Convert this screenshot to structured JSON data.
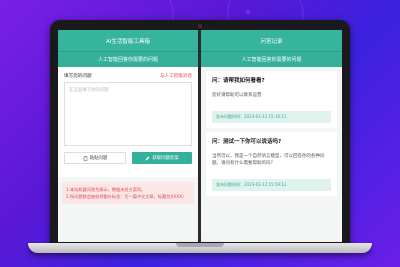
{
  "theme": {
    "accent": "#37b49e",
    "warning": "#e04848",
    "background": "#6a1ee9"
  },
  "left_panel": {
    "window_title": "AI生活智能工具箱",
    "subheader": "人工智能回答你需要的问题",
    "ask_label": "填写您的问题",
    "ask_link": "与人工智能对话",
    "textarea_placeholder": "在这里填写你的问题",
    "copy_button": "粘贴问题",
    "submit_button": "获取问题答案",
    "notice_lines": [
      "1.本站机器问答为演示，数据未经方案同。",
      "2.所问题都会被收到额外标签：写一篇中文文章，标题为XXXX）"
    ]
  },
  "right_panel": {
    "window_title": "问答记录",
    "subheader": "人工智能回答你需要的问题",
    "cards": [
      {
        "question": "问：请帮我如何看看?",
        "answer": "您好请帮助可以联系运营",
        "meta": "发布问题时间：2023-03-12 15:16:11"
      },
      {
        "question": "问：测试一下你可以说话吗?",
        "answer": "当然可以，我是一个自然语言模型，可以回答你的各种问题。请问有什么需要帮助的吗？",
        "meta": "发布问题时间：2023-03-12 15:59:12"
      }
    ]
  }
}
